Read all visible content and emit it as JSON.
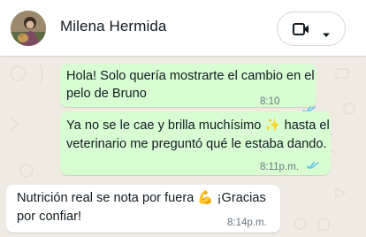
{
  "header": {
    "contact_name": "Milena Hermida",
    "call_icon": "video-camera-icon",
    "menu_icon": "chevron-down-icon"
  },
  "messages": [
    {
      "direction": "outgoing",
      "text_line1": "Hola! Solo quería mostrarte el cambio en el",
      "text_line2": "pelo de Bruno",
      "time": "8:10 p.m.",
      "status": "read"
    },
    {
      "direction": "outgoing",
      "text_line1": "Ya no se le cae y brilla muchísimo ✨ hasta el",
      "text_line2": "veterinario me preguntó qué le estaba dando.",
      "time": "8:11p.m.",
      "status": "read"
    },
    {
      "direction": "incoming",
      "text_line1": "Nutrición real se nota por fuera 💪 ¡Gracias",
      "text_line2": "por confiar!",
      "time": "8:14p.m."
    }
  ],
  "colors": {
    "chat_background": "#efeae2",
    "outgoing_bubble": "#d9fdd3",
    "incoming_bubble": "#ffffff",
    "read_ticks": "#53bdeb"
  }
}
